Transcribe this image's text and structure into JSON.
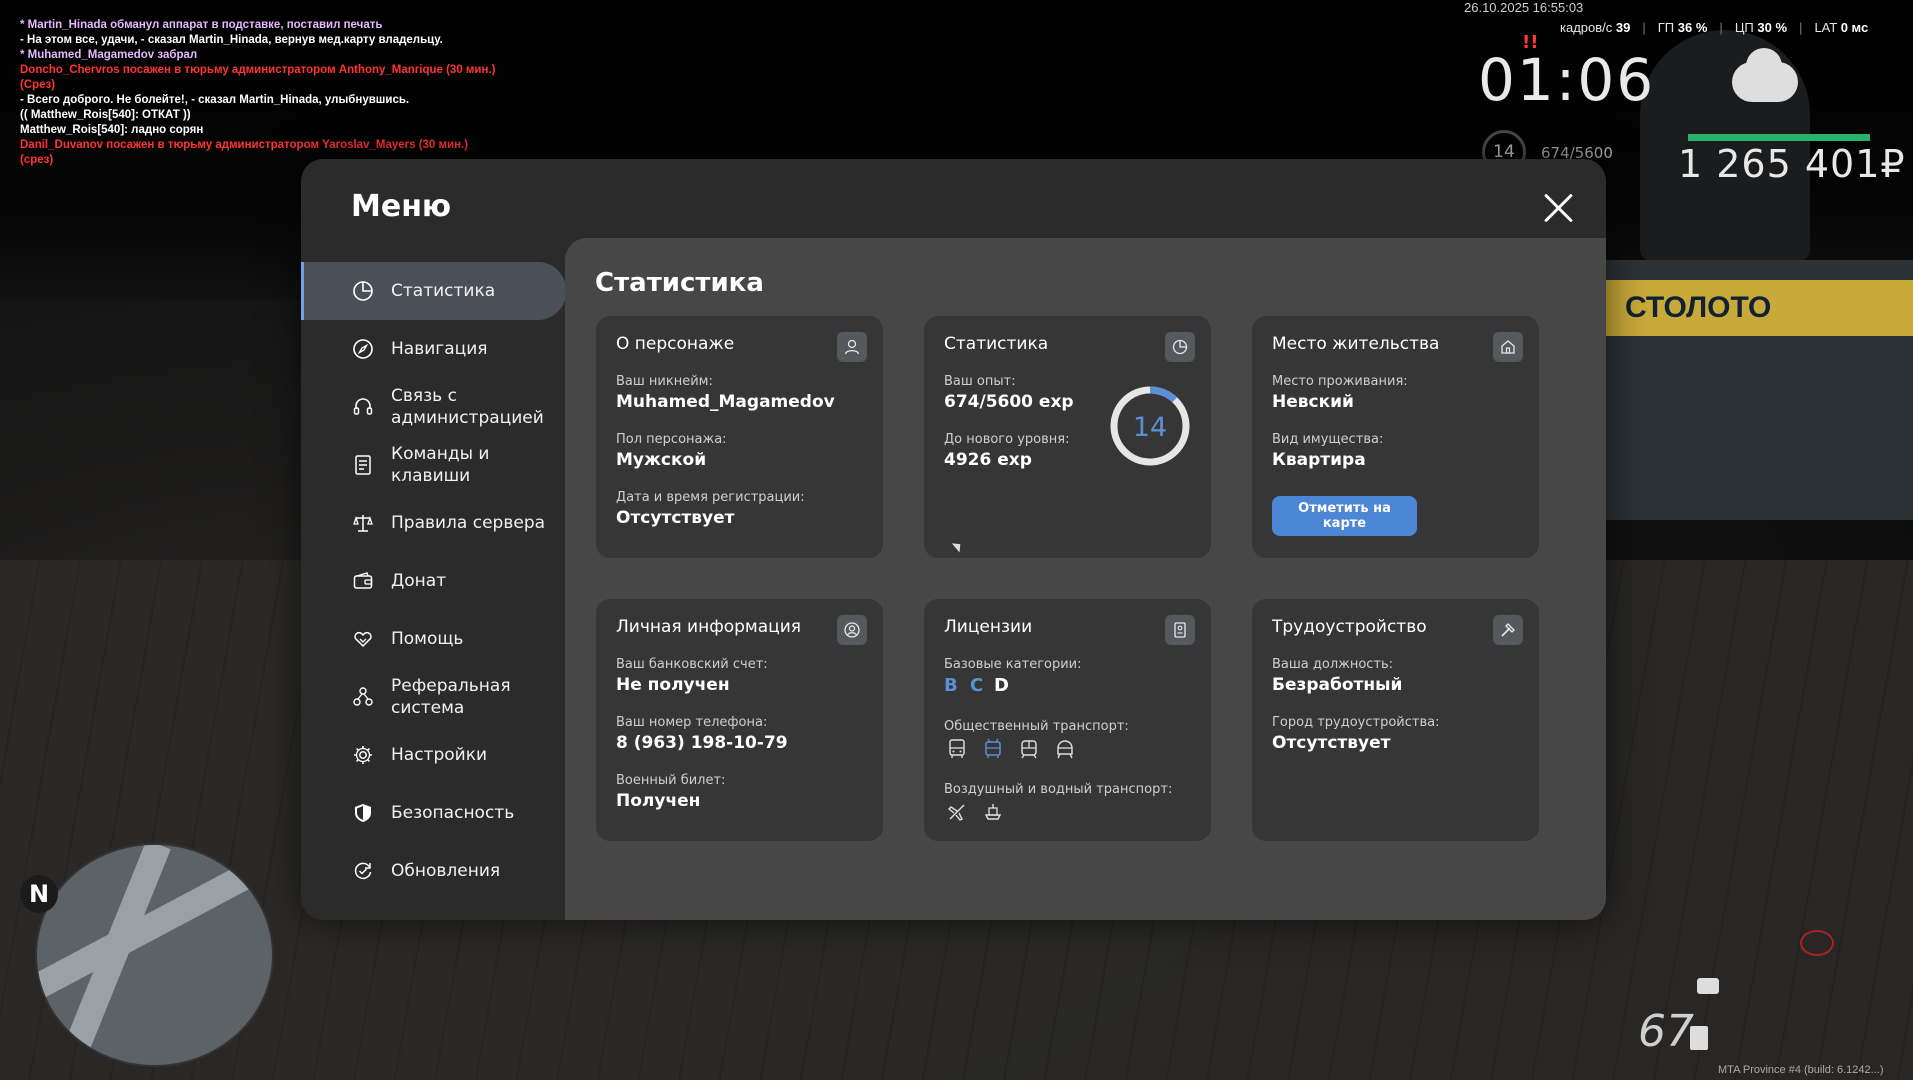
{
  "chat": {
    "lines": [
      {
        "text": "* Martin_Hinada обманул аппарат в подставке, поставил печать",
        "color": "violet"
      },
      {
        "text": "- На этом все, удачи, - сказал Martin_Hinada, вернув мед.карту владельцу.",
        "color": "white"
      },
      {
        "text": "* Muhamed_Magamedov забрал",
        "color": "violet"
      },
      {
        "text": "Doncho_Chervros посажен в тюрьму администратором Anthony_Manrique (30 мин.) (Срез)",
        "color": "red"
      },
      {
        "text": "- Всего доброго. Не болейте!, - сказал Martin_Hinada, улыбнувшись.",
        "color": "white"
      },
      {
        "text": "(( Matthew_Rois[540]: ОТКАТ ))",
        "color": "white"
      },
      {
        "text": "Matthew_Rois[540]: ладно сорян",
        "color": "white"
      },
      {
        "text": "Danil_Duvanov посажен в тюрьму администратором Yaroslav_Mayers (30 мин.) (срез)",
        "color": "red"
      }
    ]
  },
  "hud": {
    "datetime": "26.10.2025 16:55:03",
    "fps_label": "кадров/с",
    "fps_value": "39",
    "gpu_label": "ГП",
    "gpu_value": "36 %",
    "cpu_label": "ЦП",
    "cpu_value": "30 %",
    "lat_label": "LAT",
    "lat_value": "0 мс",
    "clock": "01:06",
    "alert": "!!",
    "money": "1 265 401₽",
    "level": "14",
    "exp": "674/5600",
    "speed": "67",
    "build": "MTA Province #4 (build: 6.1242...)",
    "health_fraction": 0.98,
    "sign_text": "СТОЛОТО",
    "minimap_north": "N"
  },
  "menu": {
    "title": "Меню",
    "close_label": "close",
    "sidebar": [
      {
        "label": "Статистика",
        "icon": "pie-chart-icon",
        "active": true
      },
      {
        "label": "Навигация",
        "icon": "compass-icon",
        "active": false
      },
      {
        "label": "Связь с администрацией",
        "icon": "headset-icon",
        "active": false
      },
      {
        "label": "Команды и клавиши",
        "icon": "document-list-icon",
        "active": false
      },
      {
        "label": "Правила сервера",
        "icon": "scales-icon",
        "active": false
      },
      {
        "label": "Донат",
        "icon": "wallet-icon",
        "active": false
      },
      {
        "label": "Помощь",
        "icon": "handshake-heart-icon",
        "active": false
      },
      {
        "label": "Реферальная система",
        "icon": "referral-icon",
        "active": false
      },
      {
        "label": "Настройки",
        "icon": "gear-icon",
        "active": false
      },
      {
        "label": "Безопасность",
        "icon": "shield-icon",
        "active": false
      },
      {
        "label": "Обновления",
        "icon": "refresh-check-icon",
        "active": false
      }
    ]
  },
  "content": {
    "title": "Статистика",
    "character": {
      "title": "О персонаже",
      "icon": "user-icon",
      "nickname_label": "Ваш никнейм:",
      "nickname": "Muhamed_Magamedov",
      "gender_label": "Пол персонажа:",
      "gender": "Мужской",
      "reg_label": "Дата и время регистрации:",
      "reg": "Отсутствует"
    },
    "stats": {
      "title": "Статистика",
      "icon": "pie-chart-icon",
      "exp_label": "Ваш опыт:",
      "exp": "674/5600 exp",
      "next_label": "До нового уровня:",
      "next": "4926 exp",
      "level": "14",
      "level_progress": 0.12
    },
    "residence": {
      "title": "Место жительства",
      "icon": "house-icon",
      "place_label": "Место проживания:",
      "place": "Невский",
      "type_label": "Вид имущества:",
      "type": "Квартира",
      "button": "Отметить на карте"
    },
    "personal": {
      "title": "Личная информация",
      "icon": "user-circle-icon",
      "bank_label": "Ваш банковский счет:",
      "bank": "Не получен",
      "phone_label": "Ваш номер телефона:",
      "phone": "8 (963) 198-10-79",
      "military_label": "Военный билет:",
      "military": "Получен"
    },
    "licenses": {
      "title": "Лицензии",
      "icon": "id-card-icon",
      "base_label": "Базовые категории:",
      "categories": [
        {
          "letter": "B",
          "color": "#5b8fd6"
        },
        {
          "letter": "C",
          "color": "#5b8fd6"
        },
        {
          "letter": "D",
          "color": "#ffffff"
        }
      ],
      "public_label": "Общественный транспорт:",
      "public_icons": [
        "bus-icon",
        "trolleybus-icon",
        "tram-icon",
        "metro-icon"
      ],
      "air_label": "Воздушный и водный транспорт:",
      "air_icons": [
        "plane-icon",
        "ship-icon"
      ]
    },
    "job": {
      "title": "Трудоустройство",
      "icon": "hammer-icon",
      "position_label": "Ваша должность:",
      "position": "Безработный",
      "city_label": "Город трудоустройства:",
      "city": "Отсутствует"
    }
  },
  "colors": {
    "accent": "#4e86d6",
    "modal_bg": "#2b2b2b",
    "content_bg": "#474747",
    "card_bg": "#363636",
    "active_item": "#4a5058",
    "health": "#29b36a",
    "chat_red": "#ff3333",
    "chat_violet": "#e5b8ff"
  }
}
